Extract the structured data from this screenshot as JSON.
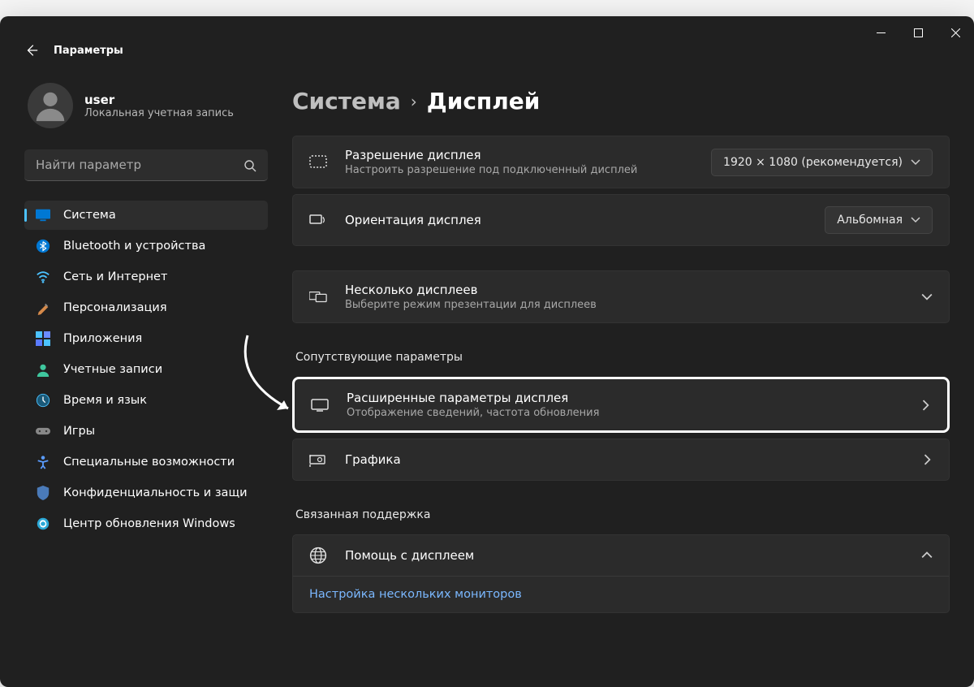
{
  "app_title": "Параметры",
  "user": {
    "name": "user",
    "subtitle": "Локальная учетная запись"
  },
  "search": {
    "placeholder": "Найти параметр"
  },
  "nav": {
    "items": [
      {
        "label": "Система"
      },
      {
        "label": "Bluetooth и устройства"
      },
      {
        "label": "Сеть и Интернет"
      },
      {
        "label": "Персонализация"
      },
      {
        "label": "Приложения"
      },
      {
        "label": "Учетные записи"
      },
      {
        "label": "Время и язык"
      },
      {
        "label": "Игры"
      },
      {
        "label": "Специальные возможности"
      },
      {
        "label": "Конфиденциальность и защи"
      },
      {
        "label": "Центр обновления Windows"
      }
    ]
  },
  "breadcrumb": {
    "parent": "Система",
    "current": "Дисплей"
  },
  "cards": {
    "resolution": {
      "title": "Разрешение дисплея",
      "subtitle": "Настроить разрешение под подключенный дисплей",
      "value": "1920 × 1080 (рекомендуется)"
    },
    "orientation": {
      "title": "Ориентация дисплея",
      "value": "Альбомная"
    },
    "multiple": {
      "title": "Несколько дисплеев",
      "subtitle": "Выберите режим презентации для дисплеев"
    },
    "related_heading": "Сопутствующие параметры",
    "advanced": {
      "title": "Расширенные параметры дисплея",
      "subtitle": "Отображение сведений, частота обновления"
    },
    "graphics": {
      "title": "Графика"
    },
    "support_heading": "Связанная поддержка",
    "help": {
      "title": "Помощь с дисплеем"
    },
    "help_link": "Настройка нескольких мониторов"
  }
}
